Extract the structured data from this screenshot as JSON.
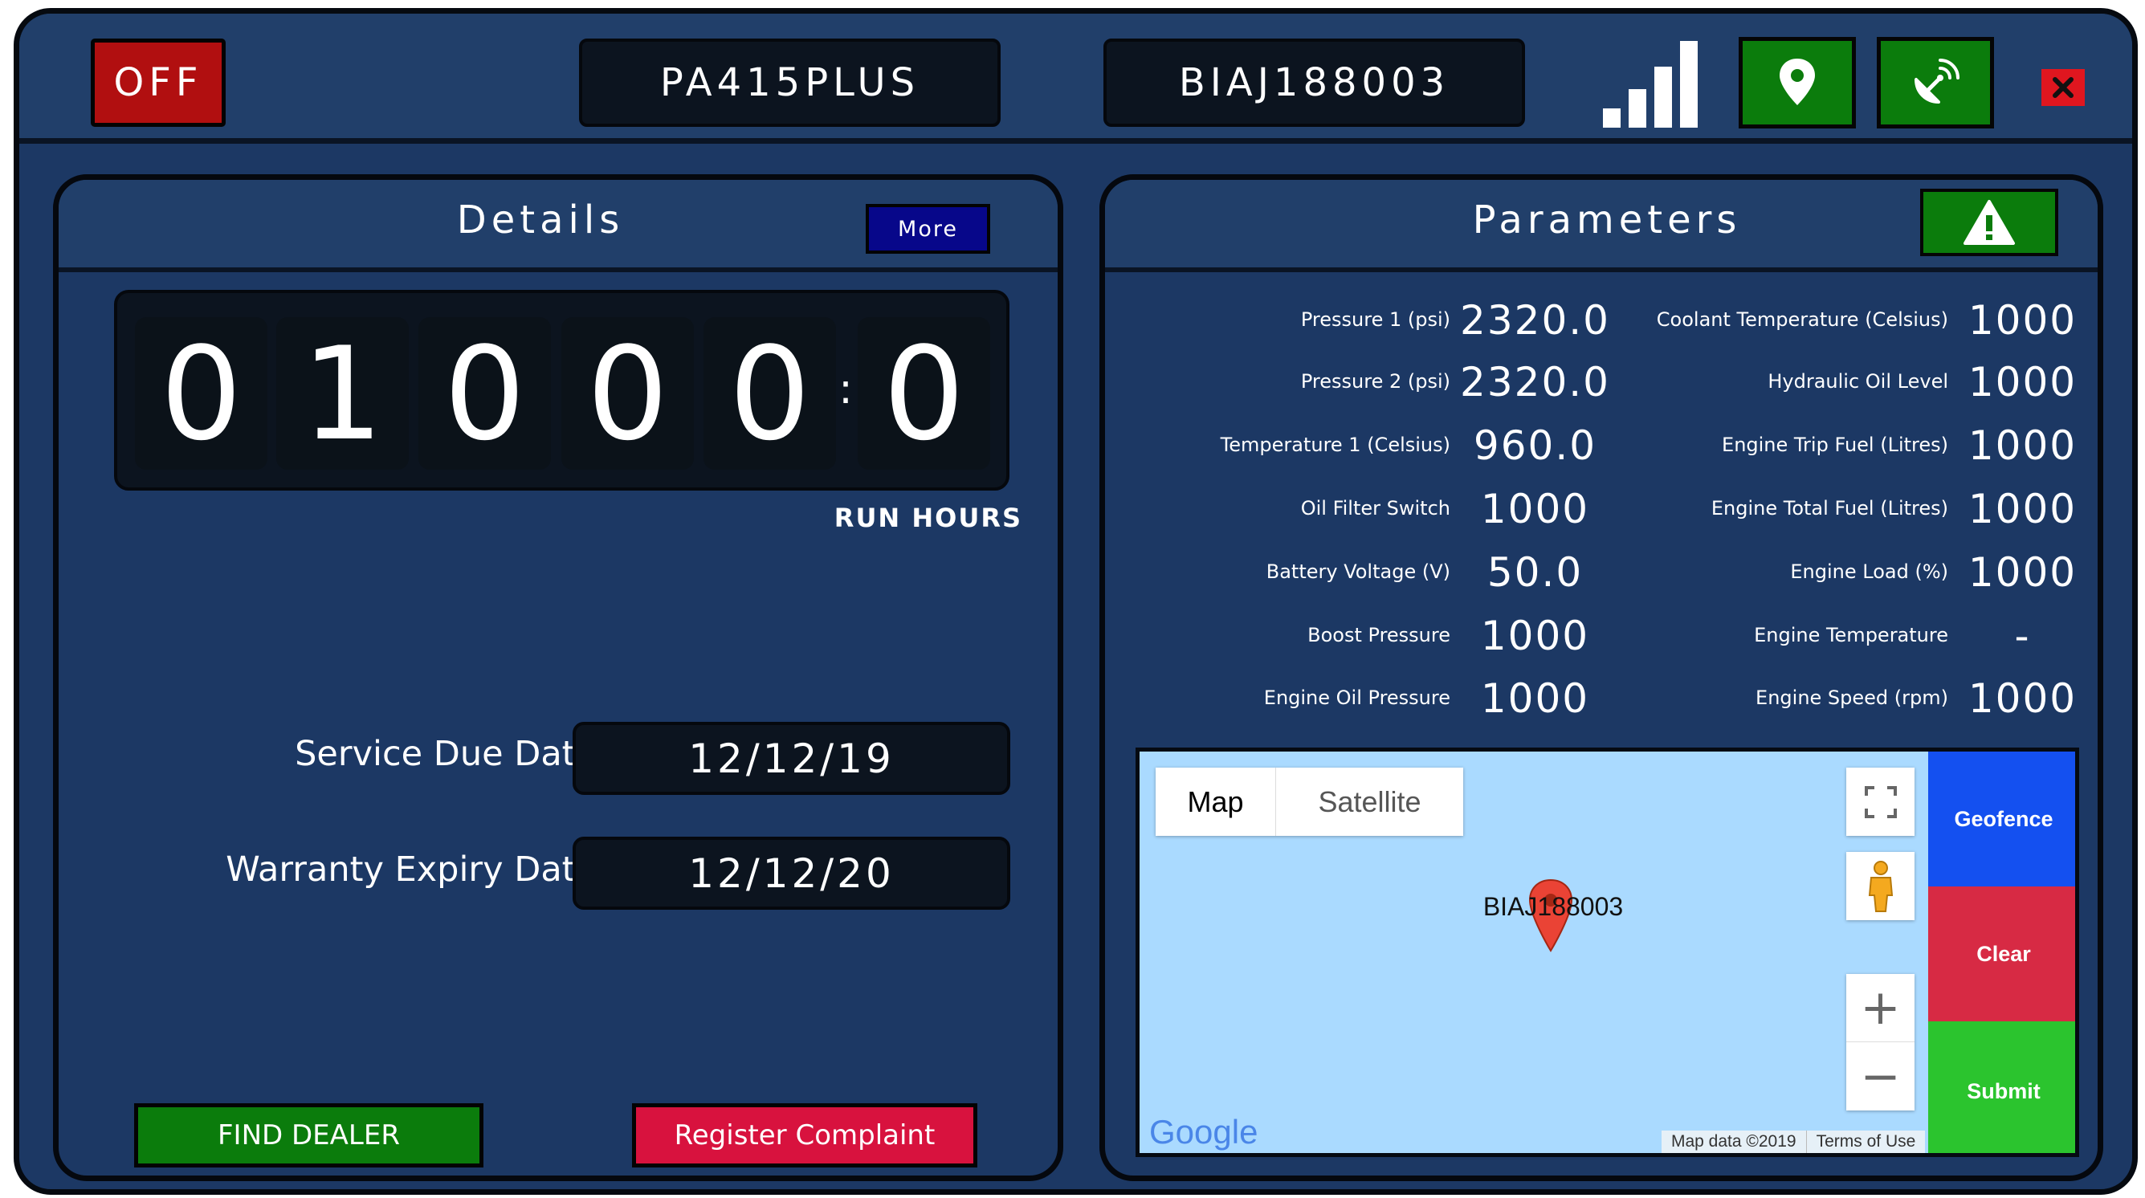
{
  "topbar": {
    "power_status": "OFF",
    "model": "PA415PLUS",
    "serial": "BIAJ188003",
    "icons": [
      "signal-icon",
      "location-pin-icon",
      "satellite-dish-icon",
      "close-icon"
    ],
    "colors": {
      "off": "#b10f10",
      "green": "#0b7c0c",
      "close": "#e0161f"
    }
  },
  "details": {
    "title": "Details",
    "more_label": "More",
    "run_hours_digits": [
      "0",
      "1",
      "0",
      "0",
      "0",
      "0"
    ],
    "separator": ":",
    "run_hours_label": "RUN HOURS",
    "service_due_label": "Service Due Date",
    "service_due_value": "12/12/19",
    "warranty_label": "Warranty Expiry Date",
    "warranty_value": "12/12/20",
    "find_dealer_label": "FIND DEALER",
    "register_complaint_label": "Register Complaint"
  },
  "parameters": {
    "title": "Parameters",
    "alert_icon": "warning-icon",
    "left": [
      {
        "label": "Pressure 1 (psi)",
        "value": "2320.0"
      },
      {
        "label": "Pressure 2 (psi)",
        "value": "2320.0"
      },
      {
        "label": "Temperature 1 (Celsius)",
        "value": "960.0"
      },
      {
        "label": "Oil Filter Switch",
        "value": "1000"
      },
      {
        "label": "Battery Voltage (V)",
        "value": "50.0"
      },
      {
        "label": "Boost Pressure",
        "value": "1000"
      },
      {
        "label": "Engine Oil Pressure",
        "value": "1000"
      }
    ],
    "right": [
      {
        "label": "Coolant Temperature (Celsius)",
        "value": "1000"
      },
      {
        "label": "Hydraulic Oil Level",
        "value": "1000"
      },
      {
        "label": "Engine Trip Fuel (Litres)",
        "value": "1000"
      },
      {
        "label": "Engine Total Fuel (Litres)",
        "value": "1000"
      },
      {
        "label": "Engine Load (%)",
        "value": "1000"
      },
      {
        "label": "Engine Temperature",
        "value": "-"
      },
      {
        "label": "Engine Speed (rpm)",
        "value": "1000"
      }
    ]
  },
  "map": {
    "tab_map": "Map",
    "tab_satellite": "Satellite",
    "marker_label": "BIAJ188003",
    "zoom_in": "+",
    "zoom_out": "−",
    "logo": "Google",
    "attribution": "Map data ©2019",
    "terms": "Terms of Use",
    "geofence_label": "Geofence",
    "clear_label": "Clear",
    "submit_label": "Submit",
    "colors": {
      "water": "#aadaff",
      "geofence": "#1450f0",
      "clear": "#d72a44",
      "submit": "#2bc42e"
    }
  }
}
